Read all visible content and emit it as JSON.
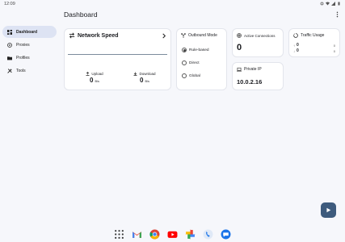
{
  "status_bar": {
    "time": "12:09"
  },
  "page": {
    "title": "Dashboard"
  },
  "sidebar": {
    "items": [
      {
        "label": "Dashboard",
        "icon": "dashboard-icon",
        "active": true
      },
      {
        "label": "Proxies",
        "icon": "proxies-icon",
        "active": false
      },
      {
        "label": "Profiles",
        "icon": "folder-icon",
        "active": false
      },
      {
        "label": "Tools",
        "icon": "tools-icon",
        "active": false
      }
    ]
  },
  "network_speed": {
    "title": "Network Speed",
    "upload": {
      "label": "Upload",
      "value": "0",
      "unit": "B/s"
    },
    "download": {
      "label": "Download",
      "value": "0",
      "unit": "B/s"
    }
  },
  "outbound_mode": {
    "title": "Outbound Mode",
    "options": [
      {
        "label": "Rule-based",
        "checked": true
      },
      {
        "label": "Direct",
        "checked": false
      },
      {
        "label": "Global",
        "checked": false
      }
    ]
  },
  "active_connections": {
    "title": "Active Connections",
    "value": "0"
  },
  "traffic_usage": {
    "title": "Traffic Usage",
    "up": {
      "arrow": "↑",
      "value": "0",
      "total": "0"
    },
    "down": {
      "arrow": "↓",
      "value": "0",
      "total": "0"
    }
  },
  "private_ip": {
    "title": "Private IP",
    "value": "10.0.2.16"
  },
  "colors": {
    "background": "#f6f7fb",
    "active_nav": "#dde3f3",
    "fab": "#3e5b7d",
    "chart_line": "#7c8c9c"
  },
  "dock": {
    "apps": [
      "app-drawer-icon",
      "gmail-icon",
      "chrome-icon",
      "youtube-icon",
      "photos-icon",
      "phone-icon",
      "messages-icon"
    ]
  }
}
